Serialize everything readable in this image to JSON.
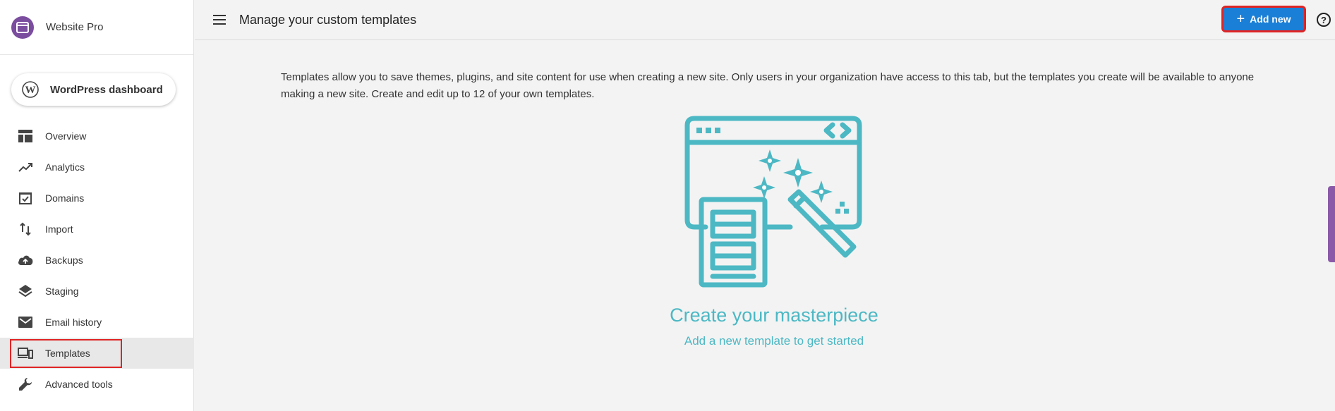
{
  "brand": {
    "name": "Website Pro",
    "icon": "browser-window-icon"
  },
  "wp_dashboard": {
    "label": "WordPress dashboard",
    "icon": "wordpress-icon"
  },
  "nav": [
    {
      "label": "Overview",
      "icon": "dashboard-icon"
    },
    {
      "label": "Analytics",
      "icon": "trending-up-icon"
    },
    {
      "label": "Domains",
      "icon": "check-box-icon"
    },
    {
      "label": "Import",
      "icon": "import-arrows-icon"
    },
    {
      "label": "Backups",
      "icon": "cloud-upload-icon"
    },
    {
      "label": "Staging",
      "icon": "layers-icon"
    },
    {
      "label": "Email history",
      "icon": "email-icon"
    },
    {
      "label": "Templates",
      "icon": "devices-icon",
      "active": true
    },
    {
      "label": "Advanced tools",
      "icon": "wrench-icon"
    }
  ],
  "header": {
    "title": "Manage your custom templates",
    "add_label": "Add new",
    "help_label": "?"
  },
  "main": {
    "intro": "Templates allow you to save themes, plugins, and site content for use when creating a new site. Only users in your organization have access to this tab, but the templates you create will be available to anyone making a new site. Create and edit up to 12 of your own templates.",
    "empty_title": "Create your masterpiece",
    "empty_subtitle": "Add a new template to get started"
  },
  "colors": {
    "accent": "#1a7fd6",
    "brand": "#7b4d9e",
    "illustration": "#4cb8c4",
    "highlight": "#e02424"
  }
}
